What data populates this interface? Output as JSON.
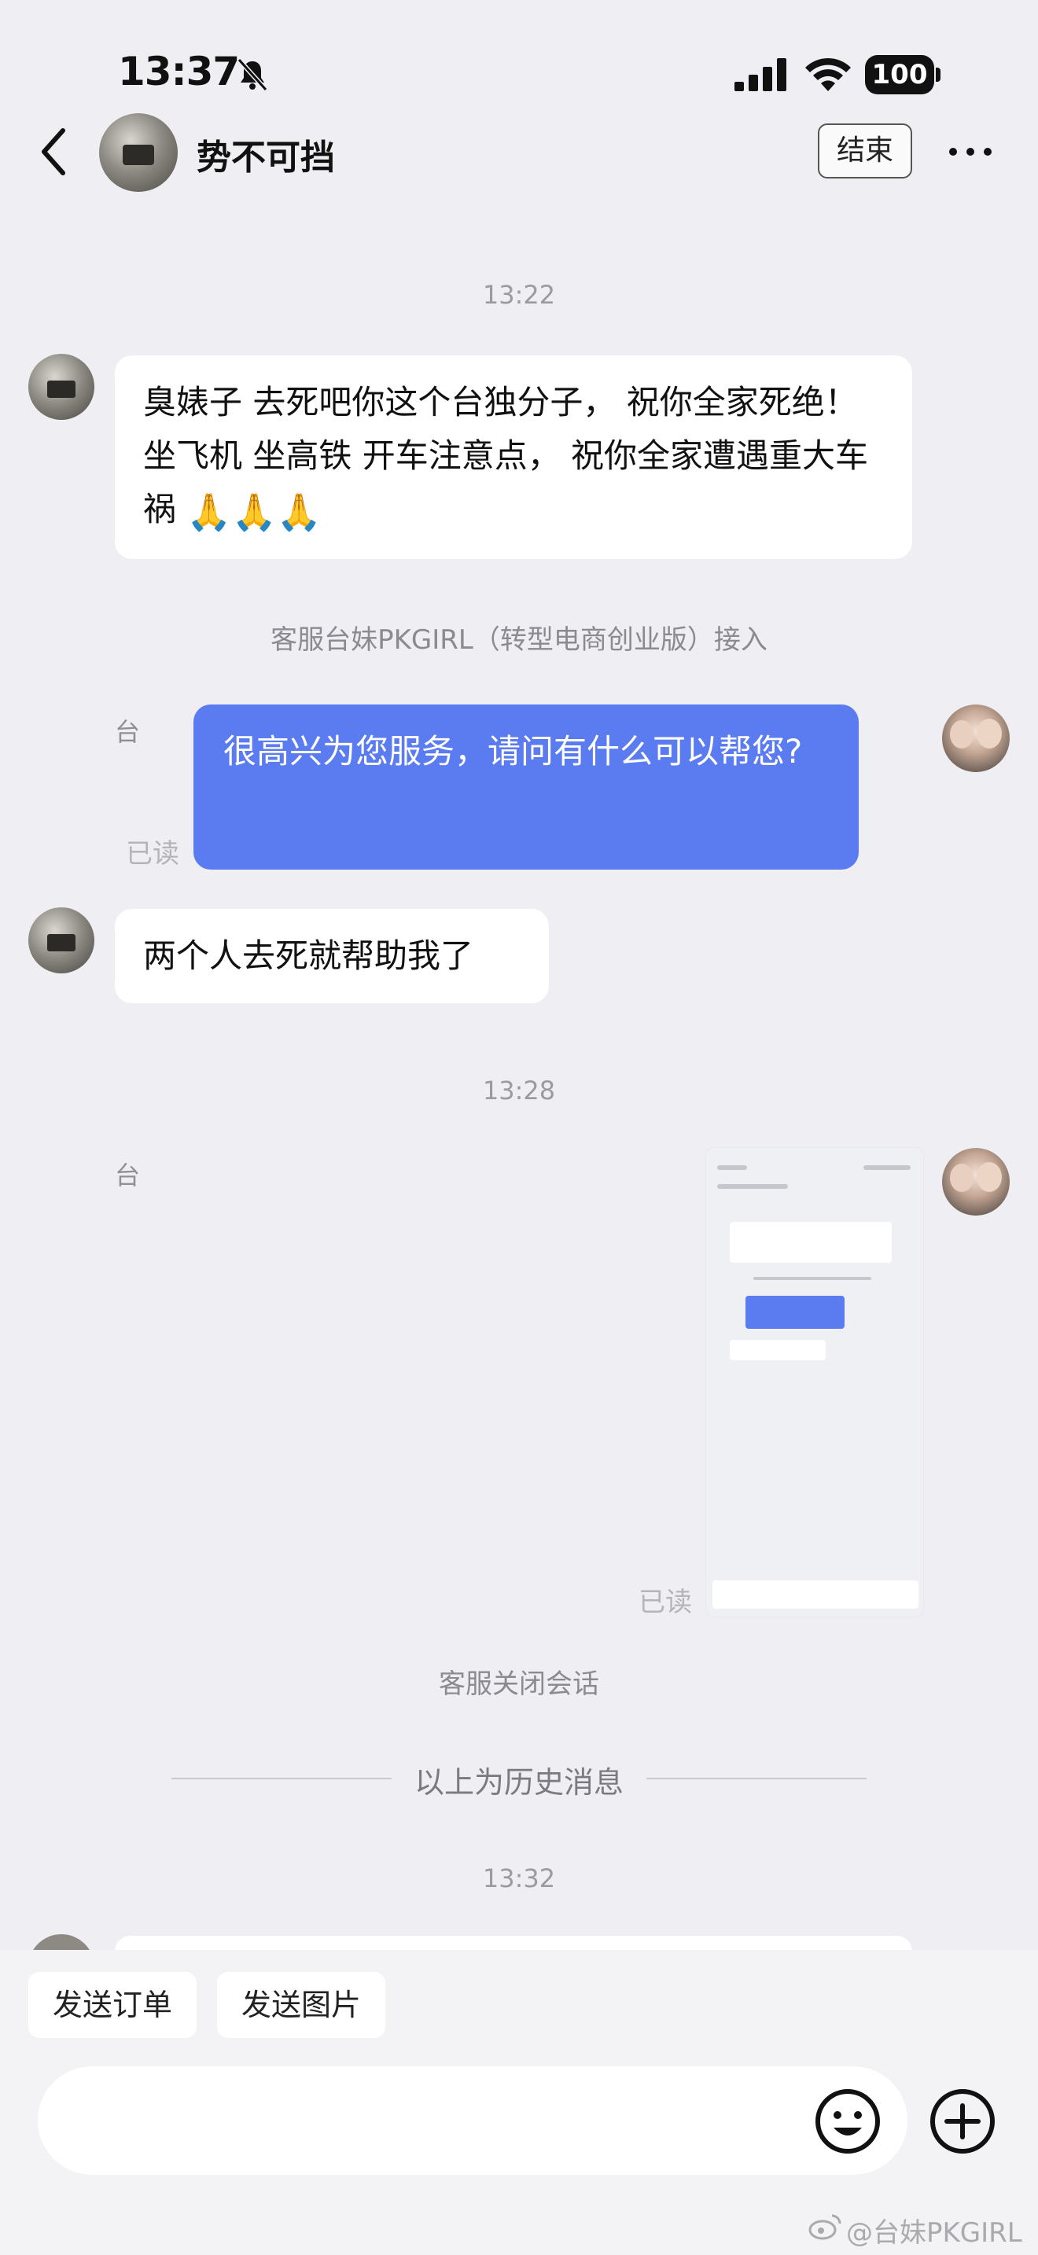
{
  "status": {
    "time": "13:37",
    "battery": "100"
  },
  "header": {
    "title": "势不可挡",
    "end_label": "结束"
  },
  "messages": {
    "ts1": "13:22",
    "m1_text": "臭婊子 去死吧你这个台独分子， 祝你全家死绝！ 坐飞机 坐高铁 开车注意点， 祝你全家遭遇重大车祸",
    "m1_emoji": "🙏🙏🙏",
    "joined": "客服台妹PKGIRL（转型电商创业版）接入",
    "sender_tag": "台",
    "m2_text": "很高兴为您服务，请问有什么可以帮您?",
    "read1": "已读",
    "m3_text": "两个人去死就帮助我了",
    "ts2": "13:28",
    "sender_tag2": "台",
    "read2": "已读",
    "closed": "客服关闭会话",
    "history": "以上为历史消息",
    "ts3": "13:32"
  },
  "quick_actions": {
    "send_order": "发送订单",
    "send_image": "发送图片"
  },
  "watermark": "@台妹PKGIRL",
  "colors": {
    "accent_blue": "#5b7cf0",
    "background": "#efeff3"
  }
}
